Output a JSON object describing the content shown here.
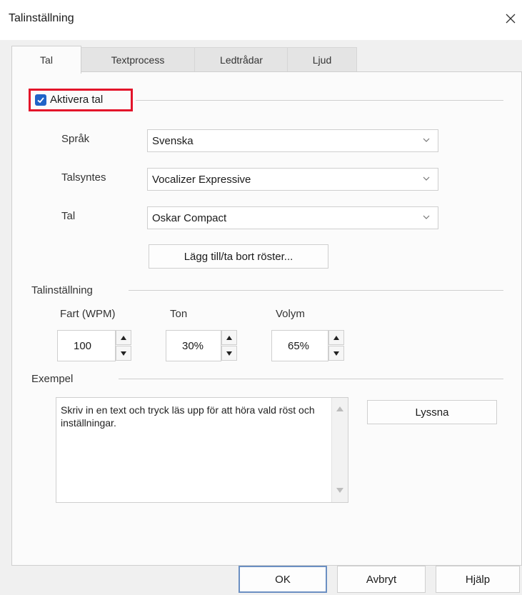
{
  "window": {
    "title": "Talinställning"
  },
  "tabs": [
    {
      "label": "Tal",
      "active": true
    },
    {
      "label": "Textprocess",
      "active": false
    },
    {
      "label": "Ledtrådar",
      "active": false
    },
    {
      "label": "Ljud",
      "active": false
    }
  ],
  "speech": {
    "enable_label": "Aktivera tal",
    "enabled": true,
    "language_label": "Språk",
    "language_value": "Svenska",
    "synth_label": "Talsyntes",
    "synth_value": "Vocalizer Expressive",
    "voice_label": "Tal",
    "voice_value": "Oskar Compact",
    "add_remove_button": "Lägg till/ta bort röster..."
  },
  "settings": {
    "group_label": "Talinställning",
    "rate_label": "Fart (WPM)",
    "rate_value": "100",
    "pitch_label": "Ton",
    "pitch_value": "30%",
    "volume_label": "Volym",
    "volume_value": "65%"
  },
  "example": {
    "group_label": "Exempel",
    "text": "Skriv in en text och tryck läs upp för att höra vald röst och inställningar.",
    "listen_button": "Lyssna"
  },
  "footer": {
    "ok": "OK",
    "cancel": "Avbryt",
    "help": "Hjälp"
  },
  "colors": {
    "accent": "#1f63c7",
    "highlight": "#e3142a",
    "background": "#f0f0f0"
  },
  "icons": [
    "close-icon",
    "checkmark-icon",
    "chevron-down-icon",
    "arrow-up-icon",
    "arrow-down-icon"
  ]
}
